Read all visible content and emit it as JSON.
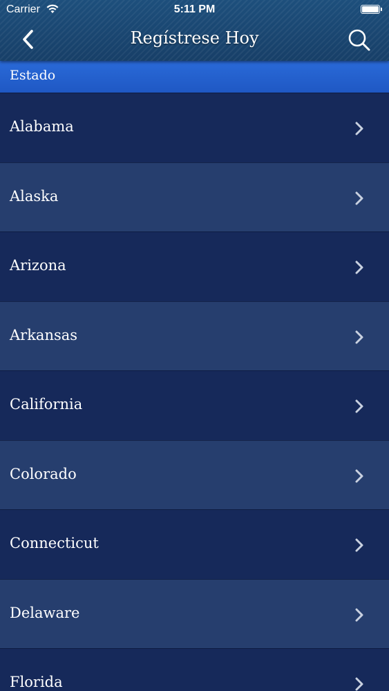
{
  "status_bar": {
    "carrier": "Carrier",
    "time": "5:11 PM",
    "wifi_icon": "wifi-icon",
    "battery_icon": "battery-icon"
  },
  "nav_bar": {
    "title": "Regístrese Hoy",
    "back_icon": "chevron-left-icon",
    "search_icon": "search-icon"
  },
  "section": {
    "header": "Estado"
  },
  "states": [
    {
      "label": "Alabama"
    },
    {
      "label": "Alaska"
    },
    {
      "label": "Arizona"
    },
    {
      "label": "Arkansas"
    },
    {
      "label": "California"
    },
    {
      "label": "Colorado"
    },
    {
      "label": "Connecticut"
    },
    {
      "label": "Delaware"
    },
    {
      "label": "Florida"
    }
  ],
  "colors": {
    "header_bg": "#1d4f7c",
    "section_header_bg": "#2a6ad8",
    "row_dark": "#16295a",
    "row_light": "#263e6e",
    "text": "#ffffff"
  }
}
